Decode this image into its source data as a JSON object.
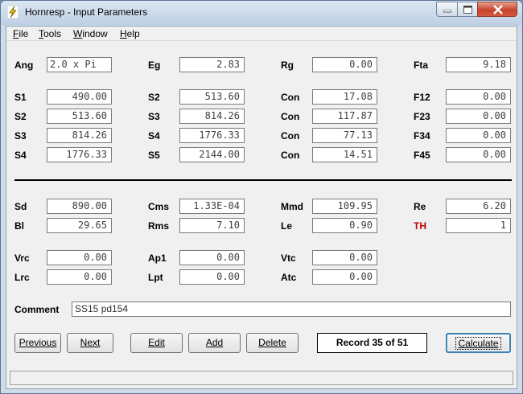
{
  "window": {
    "title": "Hornresp - Input Parameters"
  },
  "menu": {
    "file": "File",
    "tools": "Tools",
    "window": "Window",
    "help": "Help"
  },
  "params": {
    "row0": [
      {
        "label": "Ang",
        "value": "2.0 x Pi"
      },
      {
        "label": "Eg",
        "value": "2.83"
      },
      {
        "label": "Rg",
        "value": "0.00"
      },
      {
        "label": "Fta",
        "value": "9.18"
      }
    ],
    "row1": [
      {
        "label": "S1",
        "value": "490.00"
      },
      {
        "label": "S2",
        "value": "513.60"
      },
      {
        "label": "Con",
        "value": "17.08"
      },
      {
        "label": "F12",
        "value": "0.00"
      }
    ],
    "row2": [
      {
        "label": "S2",
        "value": "513.60"
      },
      {
        "label": "S3",
        "value": "814.26"
      },
      {
        "label": "Con",
        "value": "117.87"
      },
      {
        "label": "F23",
        "value": "0.00"
      }
    ],
    "row3": [
      {
        "label": "S3",
        "value": "814.26"
      },
      {
        "label": "S4",
        "value": "1776.33"
      },
      {
        "label": "Con",
        "value": "77.13"
      },
      {
        "label": "F34",
        "value": "0.00"
      }
    ],
    "row4": [
      {
        "label": "S4",
        "value": "1776.33"
      },
      {
        "label": "S5",
        "value": "2144.00"
      },
      {
        "label": "Con",
        "value": "14.51"
      },
      {
        "label": "F45",
        "value": "0.00"
      }
    ],
    "row5": [
      {
        "label": "Sd",
        "value": "890.00"
      },
      {
        "label": "Cms",
        "value": "1.33E-04"
      },
      {
        "label": "Mmd",
        "value": "109.95"
      },
      {
        "label": "Re",
        "value": "6.20"
      }
    ],
    "row6": [
      {
        "label": "Bl",
        "value": "29.65"
      },
      {
        "label": "Rms",
        "value": "7.10"
      },
      {
        "label": "Le",
        "value": "0.90"
      },
      {
        "label": "TH",
        "value": "1"
      }
    ],
    "row7": [
      {
        "label": "Vrc",
        "value": "0.00"
      },
      {
        "label": "Ap1",
        "value": "0.00"
      },
      {
        "label": "Vtc",
        "value": "0.00"
      }
    ],
    "row8": [
      {
        "label": "Lrc",
        "value": "0.00"
      },
      {
        "label": "Lpt",
        "value": "0.00"
      },
      {
        "label": "Atc",
        "value": "0.00"
      }
    ]
  },
  "comment": {
    "label": "Comment",
    "value": "SS15 pd154"
  },
  "buttons": {
    "previous": "Previous",
    "next": "Next",
    "edit": "Edit",
    "add": "Add",
    "delete": "Delete",
    "calculate": "Calculate"
  },
  "record": "Record 35 of 51",
  "status": "",
  "colors": {
    "th_label": "#c00000",
    "default_button_border": "#3c7fb1"
  }
}
